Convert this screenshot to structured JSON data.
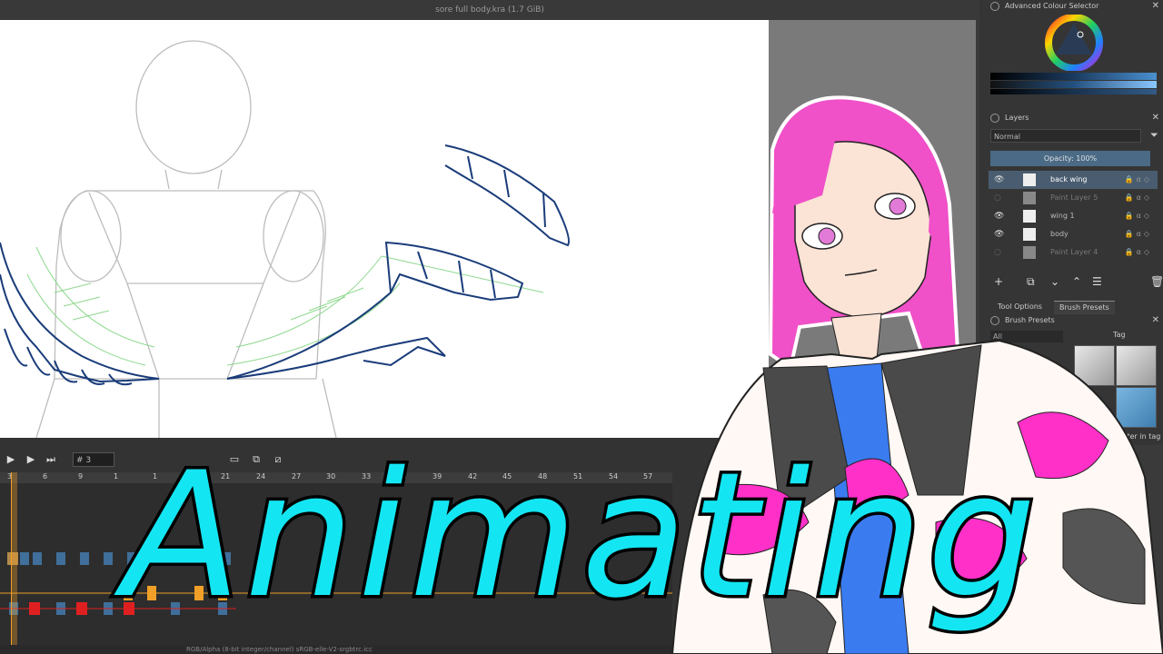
{
  "window": {
    "title": "sore full body.kra (1.7 GiB)",
    "close_glyph": "✕"
  },
  "timeline": {
    "frame_value": "# 3",
    "ruler_ticks": [
      "3",
      "6",
      "9",
      "1",
      "1",
      "1",
      "21",
      "24",
      "27",
      "30",
      "33",
      "36",
      "39",
      "42",
      "45",
      "48",
      "51",
      "54",
      "57"
    ],
    "colors": {
      "keyframe": "#3f6f9a",
      "selected_key": "#f0a028",
      "red_key": "#e02020",
      "playhead": "#f0a028"
    }
  },
  "status_bar": {
    "text": "RGB/Alpha (8-bit integer/channel)  sRGB-elle-V2-srgbtrc.icc"
  },
  "colour_selector": {
    "title": "Advanced Colour Selector"
  },
  "layers": {
    "title": "Layers",
    "blend_mode": "Normal",
    "opacity_label": "Opacity:  100%",
    "items": [
      {
        "name": "back wing",
        "selected": true
      },
      {
        "name": "Paint Layer 5",
        "selected": false
      },
      {
        "name": "wing 1",
        "selected": false
      },
      {
        "name": "body",
        "selected": false
      },
      {
        "name": "Paint Layer 4",
        "selected": false
      }
    ]
  },
  "tabs": {
    "tool_options": "Tool Options",
    "brush_presets": "Brush Presets"
  },
  "brush_presets": {
    "title": "Brush Presets",
    "filter_value": "All",
    "tag_label": "Tag",
    "filter_in_tag": "Filter in tag"
  },
  "overlay": {
    "title": "Animating",
    "title_color": "#13e6f2"
  }
}
